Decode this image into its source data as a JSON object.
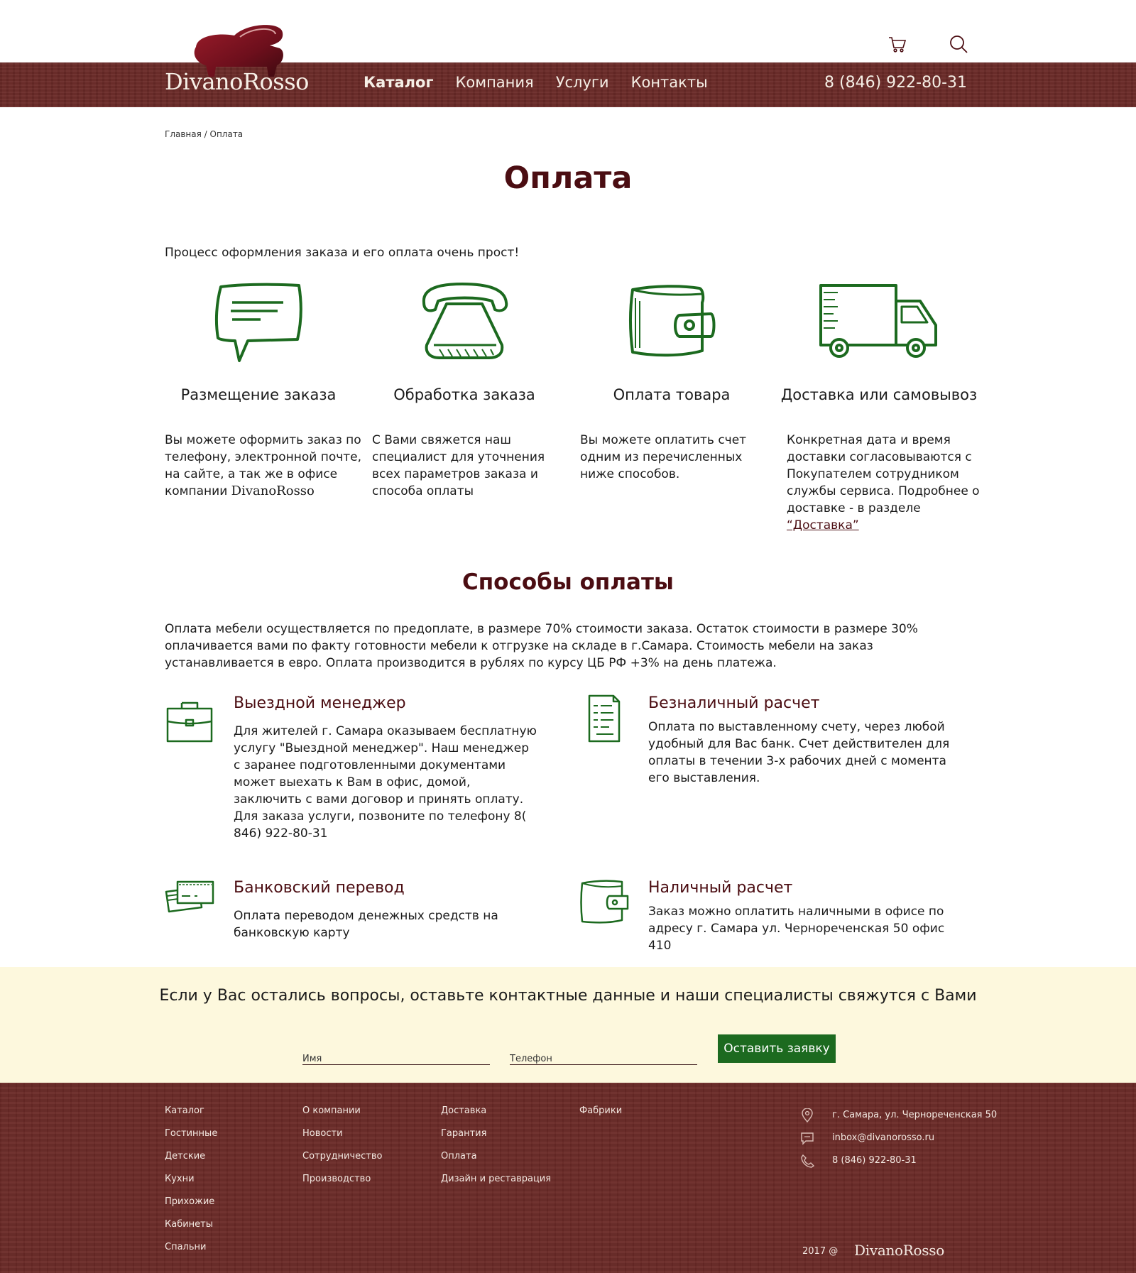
{
  "header": {
    "logo_text": "DivanoRosso",
    "nav": [
      "Каталог",
      "Компания",
      "Услуги",
      "Контакты"
    ],
    "phone": "8 (846) 922-80-31",
    "icons": [
      "cart-icon",
      "search-icon"
    ]
  },
  "breadcrumb": "Главная / Оплата",
  "page_title": "Оплата",
  "intro": "Процесс оформления заказа и его оплата очень прост!",
  "steps": [
    {
      "icon": "speech-bubble-icon",
      "title": "Размещение заказа",
      "text": "Вы можете оформить заказ по телефону, электронной почте, на сайте,  а так же в офисе компании",
      "brand": "DivanoRosso"
    },
    {
      "icon": "telephone-icon",
      "title": "Обработка заказа",
      "text": "С Вами свяжется наш специалист для уточнения всех параметров заказа и способа оплаты"
    },
    {
      "icon": "wallet-icon",
      "title": "Оплата товара",
      "text": "Вы можете оплатить счет одним из перечисленных ниже способов."
    },
    {
      "icon": "truck-icon",
      "title": "Доставка или самовывоз",
      "text": "Конкретная дата и время доставки согласовываются с Покупателем сотрудником службы сервиса. Подробнее о доставке - в разделе",
      "link": "“Доставка”"
    }
  ],
  "methods_title": "Способы оплаты",
  "methods_desc": "Оплата мебели осуществляется по предоплате, в размере 70% стоимости заказа. Остаток стоимости в размере 30% оплачивается вами по факту готовности мебели к отгрузке на складе в г.Самара. Стоимость мебели на заказ устанавливается в евро. Оплата производится в рублях по курсу ЦБ РФ +3% на день платежа.",
  "methods": [
    {
      "icon": "briefcase-icon",
      "title": "Выездной менеджер",
      "text": "Для жителей г. Самара оказываем бесплатную услугу \"Выездной менеджер\". Наш менеджер с заранее подготовленными документами может выехать к Вам в офис, домой, заключить с вами договор и принять оплату. Для заказа услуги, позвоните по телефону  8( 846) 922-80-31"
    },
    {
      "icon": "document-icon",
      "title": "Безналичный расчет",
      "text": "Оплата по выставленному счету, через любой удобный для Вас банк. Счет действителен для оплаты в течении 3-х рабочих дней с момента его выставления."
    },
    {
      "icon": "bank-cards-icon",
      "title": "Банковский перевод",
      "text": "Оплата переводом денежных средств на банковскую карту"
    },
    {
      "icon": "wallet-icon",
      "title": "Наличный расчет",
      "text": "Заказ можно оплатить наличными в  офисе по адресу г. Самара ул. Чернореченская 50 офис 410"
    }
  ],
  "request": {
    "title": "Если у Вас остались вопросы,  оставьте контактные данные и наши специалисты свяжутся с Вами",
    "name_placeholder": "Имя",
    "phone_placeholder": "Телефон",
    "button": "Оставить заявку"
  },
  "footer": {
    "col1": [
      "Каталог",
      "Гостинные",
      "Детские",
      "Кухни",
      "Прихожие",
      "Кабинеты",
      "Спальни"
    ],
    "col2": [
      "О компании",
      "Новости",
      "Сотрудничество",
      "Производство"
    ],
    "col3": [
      "Доставка",
      "Гарантия",
      "Оплата",
      "Дизайн и реставрация"
    ],
    "col4": [
      "Фабрики"
    ],
    "address": "г. Самара, ул. Чернореченская 50",
    "email": "inbox@divanorosso.ru",
    "phone": "8 (846) 922-80-31",
    "copyright": "2017 @",
    "logo_text": "DivanoRosso"
  },
  "colors": {
    "brand_dark": "#4b0d12",
    "wood": "#6a2a27",
    "icon_green": "#1c6a1f",
    "band": "#fdf8dd"
  }
}
